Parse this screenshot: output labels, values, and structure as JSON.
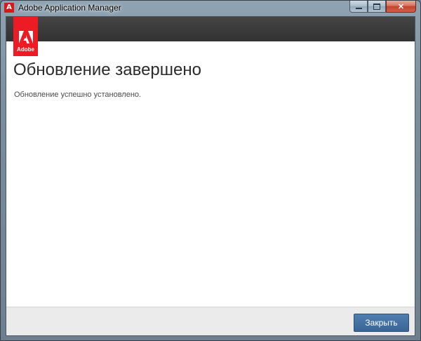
{
  "window": {
    "title": "Adobe Application Manager",
    "app_icon": "adobe-icon",
    "caption_buttons": [
      "minimize",
      "maximize",
      "close"
    ]
  },
  "header": {
    "logo_text": "Adobe",
    "logo_color": "#ed1c24",
    "bar_color": "#3c3c3c"
  },
  "main": {
    "title": "Обновление завершено",
    "message": "Обновление успешно установлено."
  },
  "footer": {
    "close_label": "Закрыть",
    "button_color": "#3f6c9f"
  }
}
